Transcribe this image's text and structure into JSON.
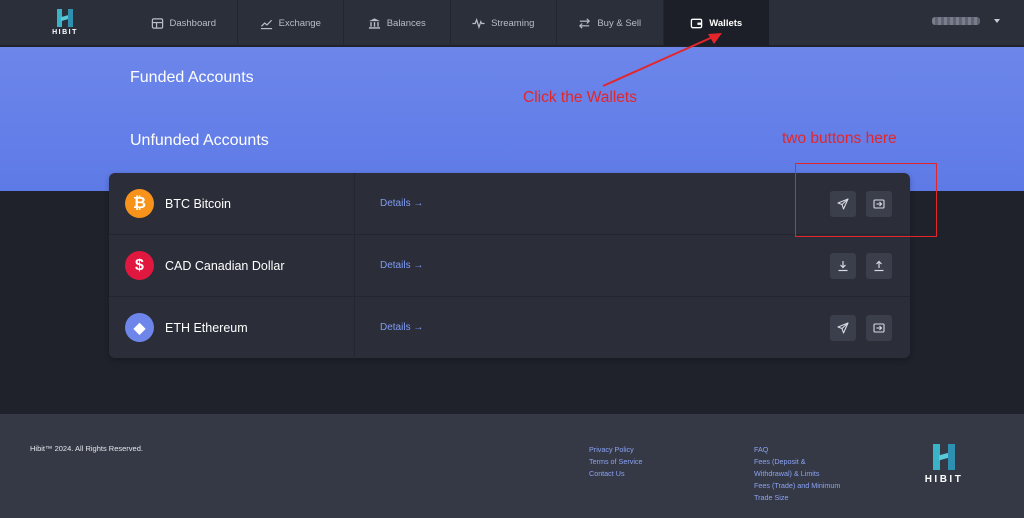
{
  "brand": {
    "logo_text": "HIBIT"
  },
  "nav": {
    "tabs": [
      {
        "label": "Dashboard",
        "icon": "dashboard-icon"
      },
      {
        "label": "Exchange",
        "icon": "chart-line-icon"
      },
      {
        "label": "Balances",
        "icon": "bank-icon"
      },
      {
        "label": "Streaming",
        "icon": "pulse-icon"
      },
      {
        "label": "Buy & Sell",
        "icon": "swap-arrows-icon"
      },
      {
        "label": "Wallets",
        "icon": "wallet-icon",
        "active": true
      }
    ],
    "user": {
      "name_blurred": "",
      "menu_icon": "chevron-down-icon"
    }
  },
  "hero": {
    "funded_title": "Funded Accounts",
    "unfunded_title": "Unfunded Accounts"
  },
  "accounts": [
    {
      "code_name": "BTC Bitcoin",
      "symbol": "₿",
      "details_label": "Details →",
      "actions": [
        "send-icon",
        "receive-icon"
      ]
    },
    {
      "code_name": "CAD Canadian Dollar",
      "symbol": "$",
      "details_label": "Details →",
      "actions": [
        "deposit-icon",
        "withdraw-icon"
      ]
    },
    {
      "code_name": "ETH Ethereum",
      "symbol": "◆",
      "details_label": "Details →",
      "actions": [
        "send-icon",
        "receive-icon"
      ]
    }
  ],
  "annotations": {
    "click_wallets": "Click the Wallets",
    "two_buttons": "two buttons here",
    "color": "#e3262b"
  },
  "footer": {
    "copyright": "Hibit™ 2024. All Rights Reserved.",
    "links_col1": [
      "Privacy Policy",
      "Terms of Service",
      "Contact Us"
    ],
    "links_col2": [
      "FAQ",
      "Fees (Deposit &",
      "Withdrawal) & Limits",
      "Fees (Trade) and Minimum",
      "Trade Size"
    ],
    "logo_text": "HIBIT"
  },
  "colors": {
    "hero_blue": "#6c86ea",
    "nav_bg": "#2b2f3a",
    "card_bg": "#2b2e39",
    "link_blue": "#7f9cf5",
    "btc_orange": "#f7931a",
    "cad_red": "#e0173f",
    "eth_blue": "#6e86ea"
  }
}
